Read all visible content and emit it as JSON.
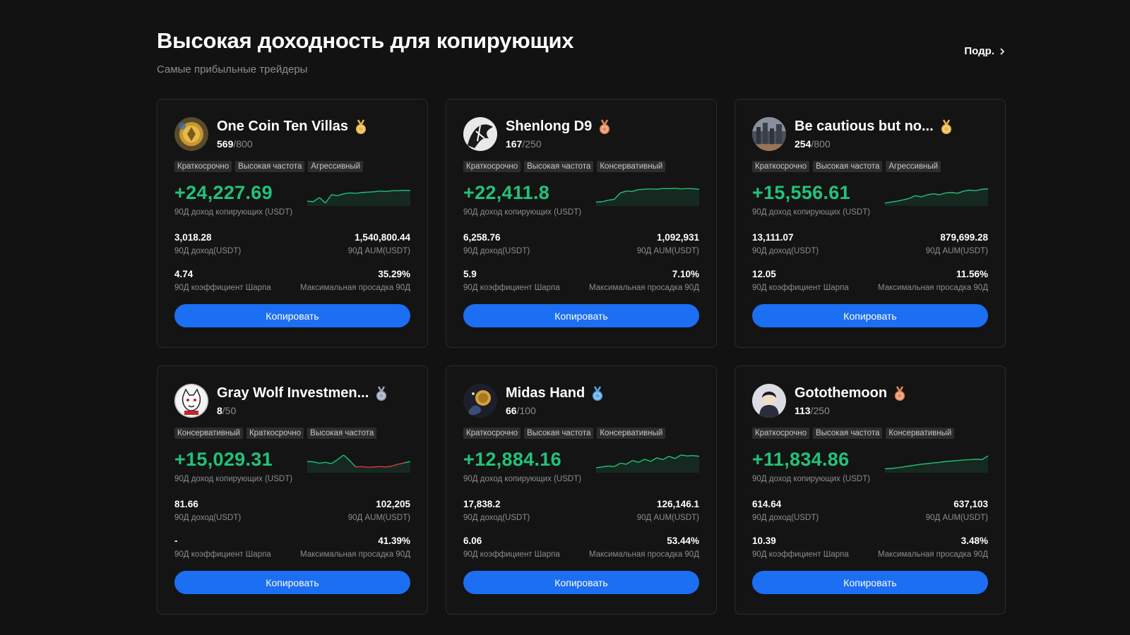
{
  "header": {
    "title": "Высокая доходность для копирующих",
    "subtitle": "Самые прибыльные трейдеры",
    "more_label": "Подр."
  },
  "colors": {
    "background": "#121212",
    "profit": "#21c37a",
    "loss": "#e0373f",
    "button": "#1c6ef2",
    "medal_gold": "#e9b64a",
    "medal_bronze": "#e58a5a",
    "medal_silver": "#9aa6b8",
    "medal_blue": "#59a8e8"
  },
  "labels": {
    "pnl_label": "90Д доход копирующих (USDT)",
    "roi_label": "90Д доход(USDT)",
    "aum_label": "90Д AUM(USDT)",
    "sharpe_label": "90Д коэффициент Шарпа",
    "drawdown_label": "Максимальная просадка 90Д",
    "copy_label": "Копировать"
  },
  "traders": [
    {
      "name": "One Coin Ten Villas",
      "medal": "gold-medal-icon",
      "avatar": "coin-avatar",
      "followers": "569",
      "capacity": "/800",
      "tags": [
        "Краткосрочно",
        "Высокая частота",
        "Агрессивный"
      ],
      "pnl": "+24,227.69",
      "roi": "3,018.28",
      "aum": "1,540,800.44",
      "sharpe": "4.74",
      "drawdown": "35.29%",
      "spark": [
        0.15,
        0.12,
        0.35,
        0.05,
        0.5,
        0.45,
        0.55,
        0.6,
        0.58,
        0.62,
        0.64,
        0.66,
        0.7,
        0.68,
        0.72,
        0.72,
        0.74,
        0.73
      ]
    },
    {
      "name": "Shenlong D9",
      "medal": "bronze-medal-icon",
      "avatar": "dragon-avatar",
      "followers": "167",
      "capacity": "/250",
      "tags": [
        "Краткосрочно",
        "Высокая частота",
        "Консервативный"
      ],
      "pnl": "+22,411.8",
      "roi": "6,258.76",
      "aum": "1,092,931",
      "sharpe": "5.9",
      "drawdown": "7.10%",
      "spark": [
        0.1,
        0.12,
        0.2,
        0.25,
        0.6,
        0.7,
        0.68,
        0.78,
        0.8,
        0.82,
        0.8,
        0.84,
        0.83,
        0.85,
        0.82,
        0.84,
        0.83,
        0.8
      ]
    },
    {
      "name": "Be cautious but no...",
      "medal": "gold-medal-icon",
      "avatar": "city-avatar",
      "followers": "254",
      "capacity": "/800",
      "tags": [
        "Краткосрочно",
        "Высокая частота",
        "Агрессивный"
      ],
      "pnl": "+15,556.61",
      "roi": "13,111.07",
      "aum": "879,699.28",
      "sharpe": "12.05",
      "drawdown": "11.56%",
      "spark": [
        0.05,
        0.1,
        0.15,
        0.22,
        0.3,
        0.45,
        0.38,
        0.5,
        0.55,
        0.5,
        0.6,
        0.62,
        0.58,
        0.7,
        0.75,
        0.72,
        0.8,
        0.82
      ]
    },
    {
      "name": "Gray Wolf Investmen...",
      "medal": "silver-medal-icon",
      "avatar": "wolf-avatar",
      "followers": "8",
      "capacity": "/50",
      "tags": [
        "Консервативный",
        "Краткосрочно",
        "Высокая частота"
      ],
      "pnl": "+15,029.31",
      "roi": "81.66",
      "aum": "102,205",
      "sharpe": "-",
      "drawdown": "41.39%",
      "spark": [
        0.5,
        0.48,
        0.4,
        0.45,
        0.38,
        0.6,
        0.85,
        0.55,
        0.2,
        0.22,
        0.18,
        0.2,
        0.22,
        0.2,
        0.25,
        0.35,
        0.42,
        0.5
      ]
    },
    {
      "name": "Midas Hand",
      "medal": "blue-medal-icon",
      "avatar": "midas-avatar",
      "followers": "66",
      "capacity": "/100",
      "tags": [
        "Краткосрочно",
        "Высокая частота",
        "Консервативный"
      ],
      "pnl": "+12,884.16",
      "roi": "17,838.2",
      "aum": "126,146.1",
      "sharpe": "6.06",
      "drawdown": "53.44%",
      "spark": [
        0.15,
        0.2,
        0.25,
        0.22,
        0.4,
        0.35,
        0.55,
        0.45,
        0.62,
        0.5,
        0.7,
        0.6,
        0.78,
        0.66,
        0.85,
        0.8,
        0.82,
        0.78
      ]
    },
    {
      "name": "Gotothemoon",
      "medal": "bronze-medal-icon",
      "avatar": "moon-avatar",
      "followers": "113",
      "capacity": "/250",
      "tags": [
        "Краткосрочно",
        "Высокая частота",
        "Консервативный"
      ],
      "pnl": "+11,834.86",
      "roi": "614.64",
      "aum": "637,103",
      "sharpe": "10.39",
      "drawdown": "3.48%",
      "spark": [
        0.1,
        0.12,
        0.15,
        0.2,
        0.25,
        0.3,
        0.35,
        0.38,
        0.42,
        0.45,
        0.5,
        0.52,
        0.55,
        0.58,
        0.6,
        0.62,
        0.6,
        0.8
      ]
    }
  ]
}
